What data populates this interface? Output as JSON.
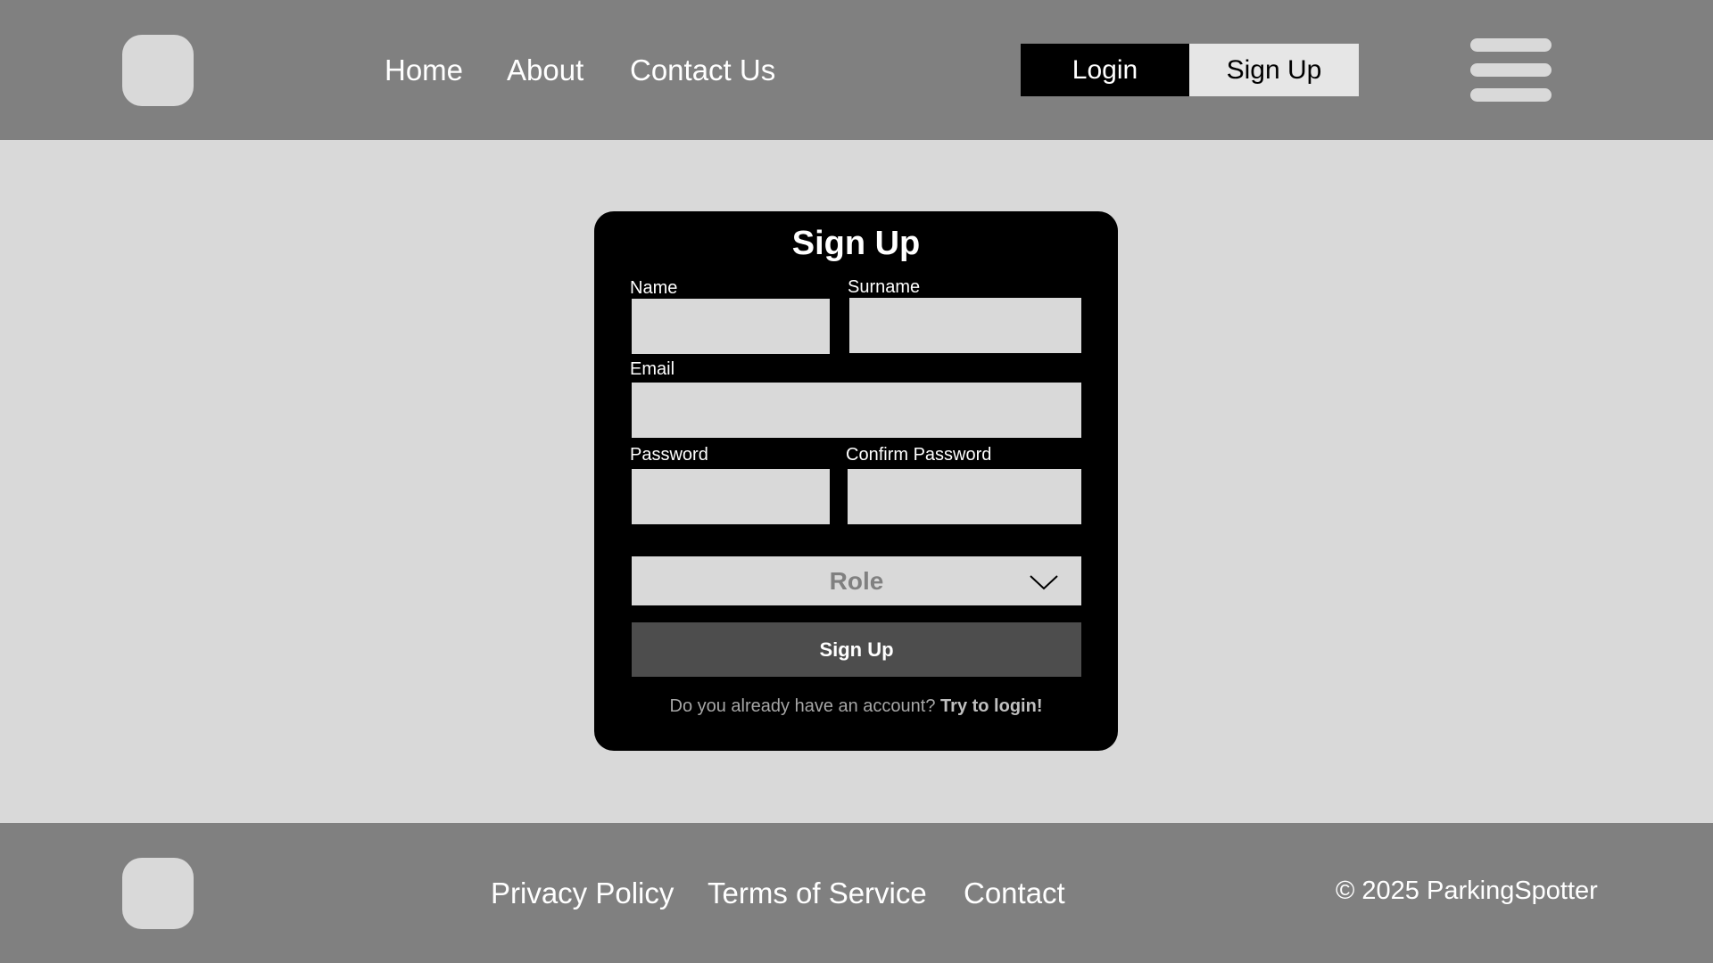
{
  "header": {
    "nav": [
      "Home",
      "About",
      "Contact Us"
    ],
    "login_label": "Login",
    "signup_label": "Sign Up"
  },
  "form": {
    "title": "Sign Up",
    "fields": {
      "name_label": "Name",
      "surname_label": "Surname",
      "email_label": "Email",
      "password_label": "Password",
      "confirm_password_label": "Confirm Password"
    },
    "role_placeholder": "Role",
    "submit_label": "Sign Up",
    "login_prompt": "Do you already have an account?",
    "login_link": "Try to login!"
  },
  "footer": {
    "links": [
      "Privacy Policy",
      "Terms of Service",
      "Contact"
    ],
    "copyright": "© 2025 ParkingSpotter"
  },
  "colors": {
    "header_footer_bg": "#808080",
    "page_bg": "#d9d9d9",
    "card_bg": "#000000",
    "submit_bg": "#4d4d4d"
  }
}
